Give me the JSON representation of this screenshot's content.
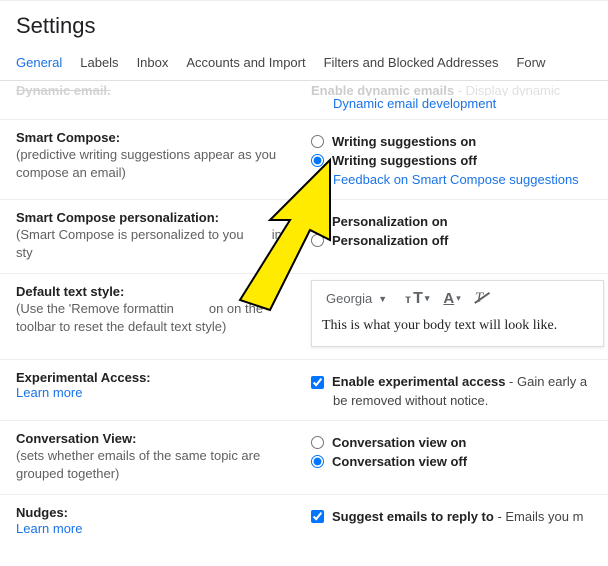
{
  "header": {
    "title": "Settings"
  },
  "tabs": [
    "General",
    "Labels",
    "Inbox",
    "Accounts and Import",
    "Filters and Blocked Addresses",
    "Forw"
  ],
  "cutoff": {
    "left_text": "Dynamic email.",
    "right_bold": "Enable dynamic emails",
    "right_rest": " - Display dynamic",
    "link": "Dynamic email development"
  },
  "smart_compose": {
    "title": "Smart Compose:",
    "desc": "(predictive writing suggestions appear as you compose an email)",
    "opt_on": "Writing suggestions on",
    "opt_off": "Writing suggestions off",
    "feedback": "Feedback on Smart Compose suggestions"
  },
  "personalization": {
    "title": "Smart Compose personalization:",
    "desc_pre": "(Smart Compose is personalized to you",
    "desc_post": "ing sty",
    "opt_on": "Personalization on",
    "opt_off": "Personalization off"
  },
  "text_style": {
    "title": "Default text style:",
    "desc_pre": "(Use the 'Remove formattin",
    "desc_post": "on on the toolbar to reset the default text style)",
    "font_name": "Georgia",
    "preview": "This is what your body text will look like."
  },
  "experimental": {
    "title": "Experimental Access:",
    "learn": "Learn more",
    "opt": "Enable experimental access",
    "extra1": " - Gain early a",
    "extra2": "be removed without notice."
  },
  "conversation": {
    "title": "Conversation View:",
    "desc": "(sets whether emails of the same topic are grouped together)",
    "opt_on": "Conversation view on",
    "opt_off": "Conversation view off"
  },
  "nudges": {
    "title": "Nudges:",
    "learn": "Learn more",
    "opt": "Suggest emails to reply to",
    "extra": " - Emails you m"
  }
}
